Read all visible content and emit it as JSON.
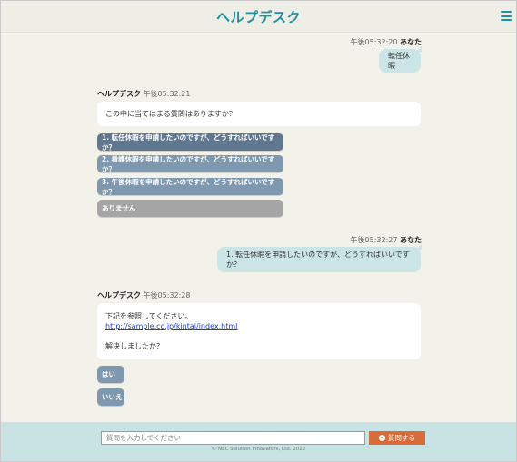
{
  "header": {
    "title": "ヘルプデスク"
  },
  "messages": {
    "m1": {
      "time": "午後05:32:20",
      "sender": "あなた",
      "text": "転任休暇"
    },
    "m2": {
      "sender": "ヘルプデスク",
      "time": "午後05:32:21",
      "text": "この中に当てはまる質問はありますか？"
    },
    "options": [
      "1. 転任休暇を申請したいのですが、どうすればいいですか？",
      "2. 看護休暇を申請したいのですが、どうすればいいですか？",
      "3. 午後休暇を申請したいのですが、どうすればいいですか？",
      "ありません"
    ],
    "m3": {
      "time": "午後05:32:27",
      "sender": "あなた",
      "text": "1. 転任休暇を申請したいのですが、どうすればいいですか？"
    },
    "m4": {
      "sender": "ヘルプデスク",
      "time": "午後05:32:28",
      "line1": "下記を参照してください。",
      "link": "http://sample.co.jp/kintai/index.html",
      "line3": "解決しましたか？"
    },
    "yes": "はい",
    "no": "いいえ"
  },
  "footer": {
    "placeholder": "質問を入力してください",
    "send_label": "質問する",
    "copyright": "© NEC Solution Innovators, Ltd. 2022"
  },
  "colors": {
    "accent": "#1f8f9f",
    "send": "#d86b3a",
    "option": "#7d98af"
  }
}
